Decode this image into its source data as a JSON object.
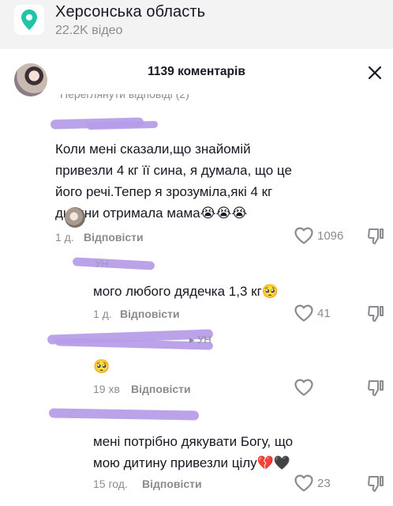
{
  "location": {
    "icon": "map-pin-icon",
    "title": "Херсонська область",
    "subtitle": "22.2K відео",
    "accent": "#20c4a6"
  },
  "sheet": {
    "title": "1139 коментарів",
    "close_icon": "close-icon",
    "view_replies_label": "Переглянути відповіді (2)"
  },
  "comments": [
    {
      "text_lines": [
        "Коли мені сказали,що знайомій",
        "привезли 4 кг її сина, я думала, що це",
        "його речі.Тепер я зрозуміла,які 4 кг",
        "дитини отримала мама😭😭😭"
      ],
      "time": "1 д.",
      "reply_label": "Відповісти",
      "likes": "1096"
    },
    {
      "username_fragment": "УН",
      "text_lines": [
        "мого любого дядечка 1,3 кг🥺"
      ],
      "time": "1 д.",
      "reply_label": "Відповісти",
      "likes": "41"
    },
    {
      "username_fragment": "▸ УН",
      "text_lines": [
        "🥺"
      ],
      "time": "19 хв",
      "reply_label": "Відповісти",
      "likes": ""
    },
    {
      "text_lines": [
        "мені потрібно дякувати Богу, що",
        "мою дитину привезли цілу💔🖤"
      ],
      "time": "15 год.",
      "reply_label": "Відповісти",
      "likes": "23"
    }
  ],
  "colors": {
    "redaction": "#b59be8",
    "muted": "#8a8b91",
    "text": "#161823"
  }
}
